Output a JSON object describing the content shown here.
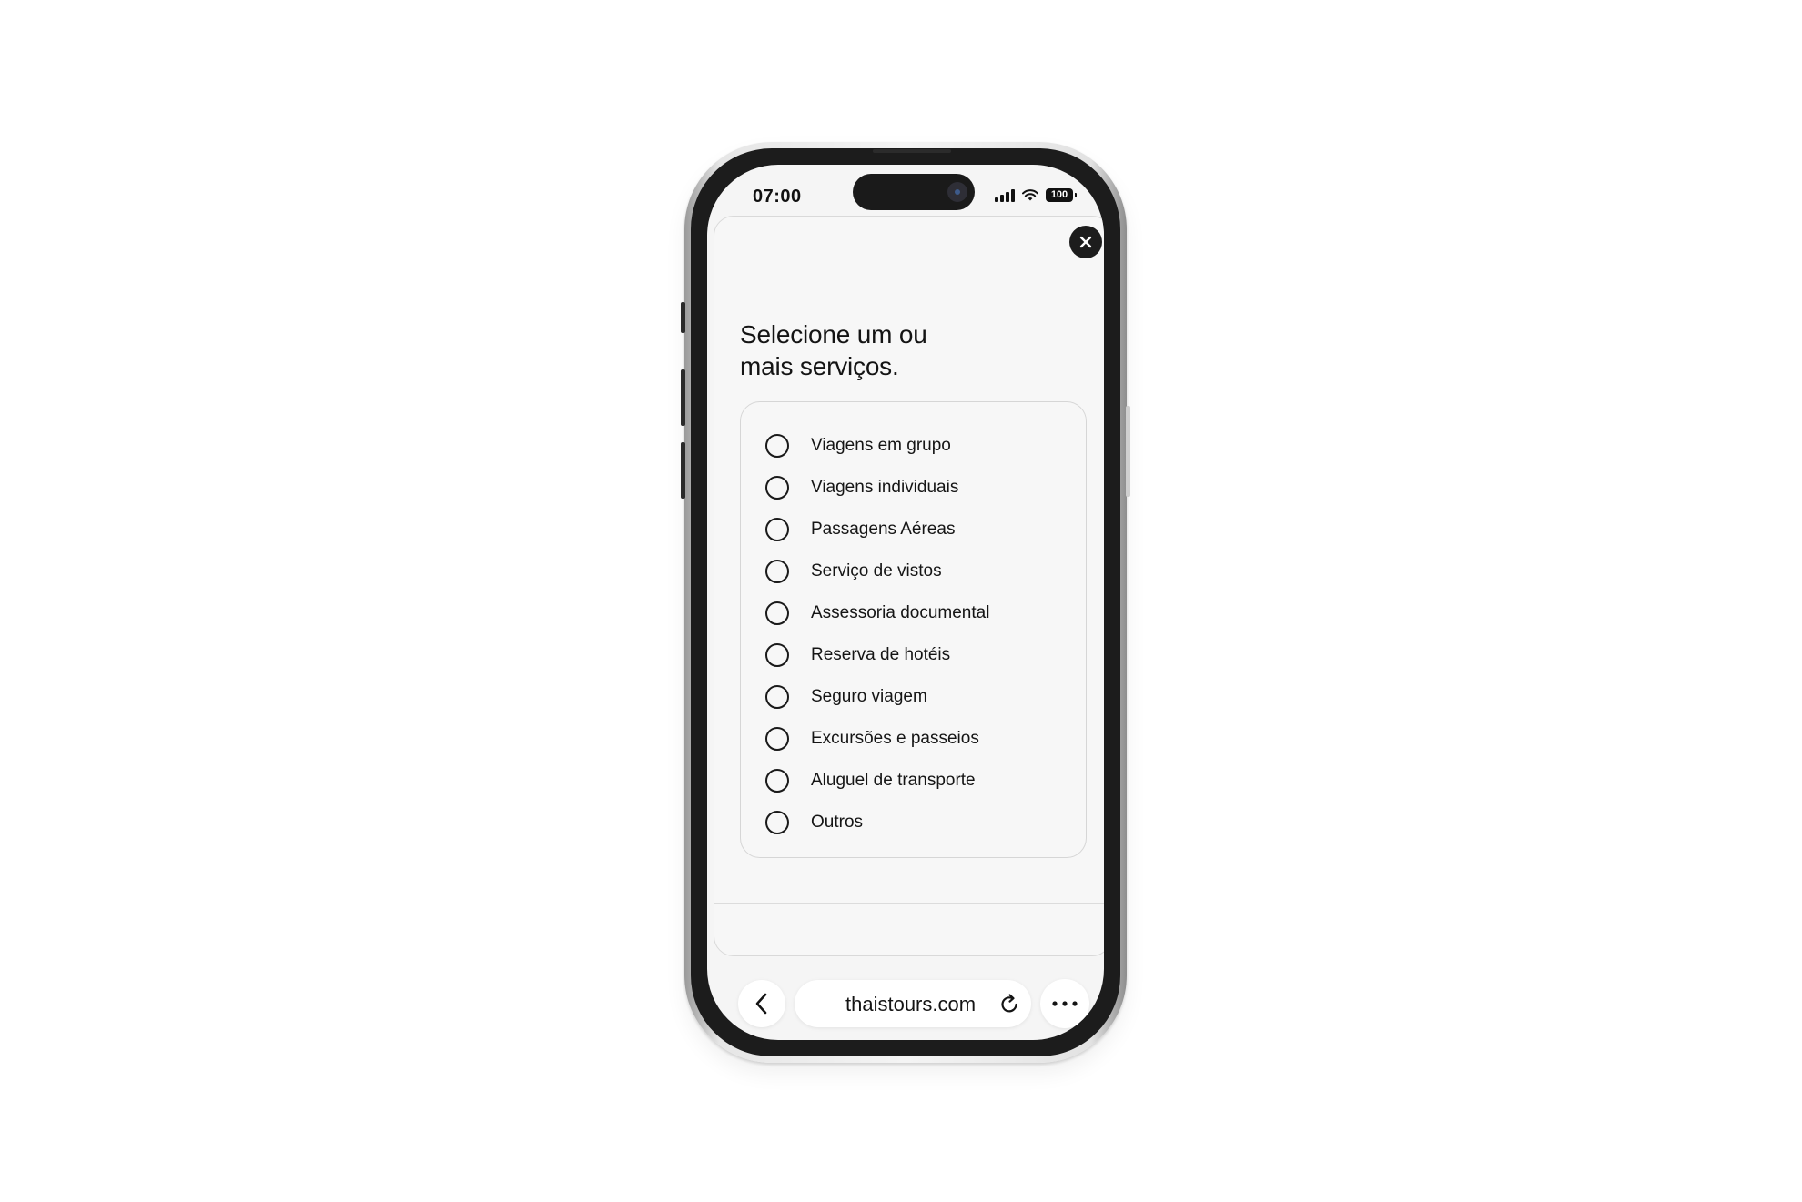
{
  "status_bar": {
    "time": "07:00",
    "battery": "100"
  },
  "modal": {
    "title_line1": "Selecione um ou",
    "title_line2": "mais serviços.",
    "close_icon": "close-icon",
    "options": [
      {
        "label": "Viagens em grupo",
        "selected": false
      },
      {
        "label": "Viagens individuais",
        "selected": false
      },
      {
        "label": "Passagens Aéreas",
        "selected": false
      },
      {
        "label": "Serviço de vistos",
        "selected": false
      },
      {
        "label": "Assessoria documental",
        "selected": false
      },
      {
        "label": "Reserva de hotéis",
        "selected": false
      },
      {
        "label": "Seguro viagem",
        "selected": false
      },
      {
        "label": "Excursões e passeios",
        "selected": false
      },
      {
        "label": "Aluguel de transporte",
        "selected": false
      },
      {
        "label": "Outros",
        "selected": false
      }
    ]
  },
  "browser": {
    "url": "thaistours.com",
    "back_icon": "chevron-left-icon",
    "reload_icon": "reload-icon",
    "more_icon": "more-icon"
  },
  "colors": {
    "screen_bg": "#f5f5f5",
    "text": "#141414",
    "close_button_bg": "#1d1d1d"
  }
}
